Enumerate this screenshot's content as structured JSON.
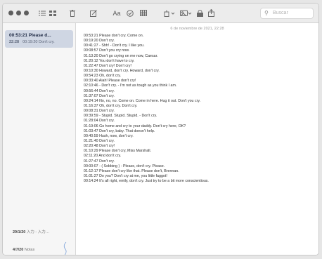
{
  "toolbar": {
    "search_placeholder": "Buscar"
  },
  "sidebar": {
    "selected_note": {
      "title": "00:53:21 Please d...",
      "date": "22:28",
      "preview": "00:19:20 Don't cry."
    },
    "lower_notes": [
      {
        "date": "29/1/20",
        "preview": "入力 - 入力…"
      },
      {
        "date": "4/7/20",
        "preview": "Notas"
      }
    ]
  },
  "note": {
    "date_header": "6 de noviembre de 2021, 22:28",
    "lines": [
      "00:53:21 Please don't cry. Come on.",
      "00:19:20 Don't cry.",
      "00:41:27 - Shh! - Don't cry. I like you.",
      "00:08:57 Don't you cry now.",
      "01:13:20 Don't go crying on me now, Caesar.",
      "01:20:12 You don't have to cry.",
      "01:22:47 Don't cry! Don't cry!",
      "00:10:30 Howard, don't cry. Howard, don't cry.",
      "00:54:23 Oh, don't cry.",
      "00:33:40 Aiah! Please don't cry!",
      "02:10:46 - Don't cry. - I'm not as tough as you think I am.",
      "00:56:44 Don't cry.",
      "01:37:07 Don't cry.",
      "00:24:14 No, no, no. Come on. Come in here. Hug it out. Don't you cry.",
      "01:16:37 Oh, don't cry. Don't cry.",
      "00:08:31 Don't cry.",
      "00:39:59 - Stupid. Stupid. Stupid. - Don't cry.",
      "01:28:04 Don't cry.",
      "01:19:06 Go home and cry to your daddy. Don't cry here, OK?",
      "01:03:47 Don't cry, baby. That doesn't help.",
      "00:40:59 Hush, now, don't cry.",
      "01:21:40 Don't cry.",
      "02:20:48 Don't cry!",
      "01:10:29 Please don't cry, Miss Marshall.",
      "02:11:20 And don't cry.",
      "01:27:47 Don't cry.",
      "00:00:07 - ( Sobbing ) - Please, don't cry. Please.",
      "01:12:17 Please don't cry like that. Please don't, Brennan.",
      "01:01:27 Do you? Don't cry at me, you little faggot!",
      "00:14:24 It's all right, emily, don't cry. Just try to be a bit more conscientious."
    ]
  }
}
